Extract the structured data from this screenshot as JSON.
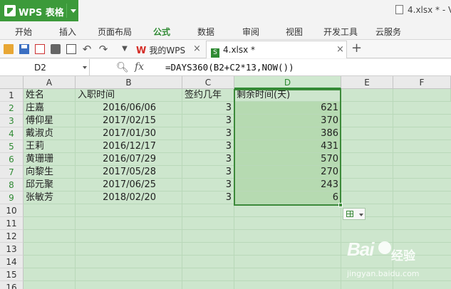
{
  "app": {
    "name": "WPS 表格",
    "window_title": "4.xlsx * - V"
  },
  "ribbon": {
    "tabs": [
      {
        "label": "开始",
        "active": false
      },
      {
        "label": "插入",
        "active": false
      },
      {
        "label": "页面布局",
        "active": false
      },
      {
        "label": "公式",
        "active": true
      },
      {
        "label": "数据",
        "active": false
      },
      {
        "label": "审阅",
        "active": false
      },
      {
        "label": "视图",
        "active": false
      },
      {
        "label": "开发工具",
        "active": false
      },
      {
        "label": "云服务",
        "active": false
      }
    ]
  },
  "toolbar": {
    "icons": [
      "open-icon",
      "save-icon",
      "export-pdf-icon",
      "print-icon",
      "print-preview-icon",
      "undo-icon",
      "redo-icon",
      "more-icon"
    ]
  },
  "doc_tabs": {
    "wps_tab": "我的WPS",
    "file_tab": "4.xlsx *",
    "add_icon": "plus-icon"
  },
  "formula_bar": {
    "cell_ref": "D2",
    "formula": "=DAYS360(B2+C2*13,NOW())"
  },
  "grid": {
    "columns": [
      "A",
      "B",
      "C",
      "D",
      "E",
      "F"
    ],
    "selected_column": "D",
    "rows": [
      "1",
      "2",
      "3",
      "4",
      "5",
      "6",
      "7",
      "8",
      "9",
      "10",
      "11",
      "12",
      "13",
      "14",
      "15",
      "16"
    ],
    "selected_rows": [
      "2",
      "3",
      "4",
      "5",
      "6",
      "7",
      "8",
      "9"
    ],
    "header": {
      "a": "姓名",
      "b": "入职时间",
      "c": "签约几年",
      "d": "剩余时间(天)"
    },
    "records": [
      {
        "name": "庄嘉",
        "date": "2016/06/06",
        "years": "3",
        "remain": "621"
      },
      {
        "name": "傅仰星",
        "date": "2017/02/15",
        "years": "3",
        "remain": "370"
      },
      {
        "name": "戴淑贞",
        "date": "2017/01/30",
        "years": "3",
        "remain": "386"
      },
      {
        "name": "王莉",
        "date": "2016/12/17",
        "years": "3",
        "remain": "431"
      },
      {
        "name": "黄珊珊",
        "date": "2016/07/29",
        "years": "3",
        "remain": "570"
      },
      {
        "name": "向黎生",
        "date": "2017/05/28",
        "years": "3",
        "remain": "270"
      },
      {
        "name": "邱元聚",
        "date": "2017/06/25",
        "years": "3",
        "remain": "243"
      },
      {
        "name": "张敏芳",
        "date": "2018/02/20",
        "years": "3",
        "remain": "6"
      }
    ]
  },
  "watermark": {
    "brand": "Bai",
    "brand_cn": "经验",
    "url": "jingyan.baidu.com"
  },
  "colors": {
    "accent": "#2f8a33",
    "app_button": "#3c9a3a",
    "sheet_bg": "#cde6cd",
    "selection_fill": "#b6dab1"
  }
}
